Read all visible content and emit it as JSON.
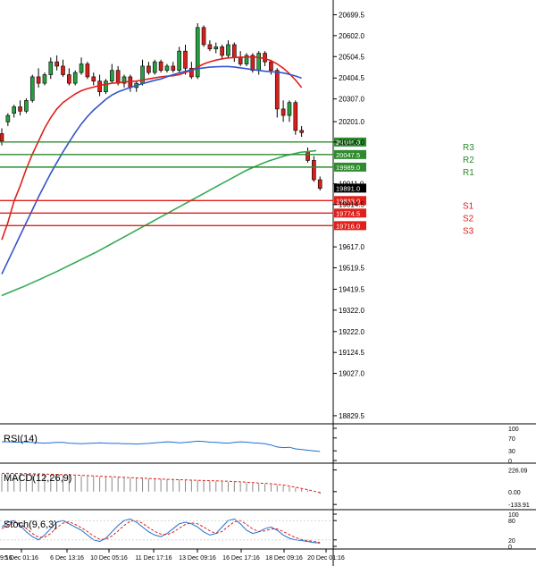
{
  "chart_data": [
    {
      "type": "candlestick",
      "title": "",
      "y_ticks": [
        "20699.5",
        "20602.0",
        "20504.5",
        "20404.5",
        "20307.0",
        "20201.0",
        "20106.0",
        "19911.0",
        "19814.5",
        "19617.0",
        "19519.5",
        "19419.5",
        "19322.0",
        "19222.0",
        "19124.5",
        "19027.0",
        "18829.5"
      ],
      "ylim": [
        18800,
        20760
      ],
      "x_ticks": [
        "5 Dec 01:16",
        "6 Dec 13:16",
        "10 Dec 05:16",
        "11 Dec 17:16",
        "13 Dec 09:16",
        "16 Dec 17:16",
        "18 Dec 09:16",
        "20 Dec 01:16"
      ],
      "x_tick_left_partial": "9:16",
      "current_price": "19891.0",
      "levels": [
        {
          "name": "R3",
          "value": 20106.0,
          "label": "20106.0",
          "color": "#2e8b2e"
        },
        {
          "name": "R2",
          "value": 20047.5,
          "label": "20047.5",
          "color": "#2e8b2e"
        },
        {
          "name": "R1",
          "value": 19989.0,
          "label": "19989.0",
          "color": "#2e8b2e"
        },
        {
          "name": "S1",
          "value": 19833.0,
          "label": "19833.0",
          "color": "#e0201a"
        },
        {
          "name": "S2",
          "value": 19774.5,
          "label": "19774.5",
          "color": "#e0201a"
        },
        {
          "name": "S3",
          "value": 19716.0,
          "label": "19716.0",
          "color": "#e0201a"
        }
      ],
      "hidden_label_fragments": [
        "20013.0",
        "19814.5"
      ],
      "candles": [
        {
          "o": 20145,
          "h": 20170,
          "c": 20110,
          "l": 20090
        },
        {
          "o": 20200,
          "h": 20240,
          "c": 20230,
          "l": 20180
        },
        {
          "o": 20240,
          "h": 20280,
          "c": 20270,
          "l": 20220
        },
        {
          "o": 20270,
          "h": 20300,
          "c": 20250,
          "l": 20230
        },
        {
          "o": 20250,
          "h": 20310,
          "c": 20300,
          "l": 20240
        },
        {
          "o": 20300,
          "h": 20420,
          "c": 20410,
          "l": 20290
        },
        {
          "o": 20410,
          "h": 20450,
          "c": 20380,
          "l": 20360
        },
        {
          "o": 20380,
          "h": 20430,
          "c": 20420,
          "l": 20370
        },
        {
          "o": 20420,
          "h": 20500,
          "c": 20480,
          "l": 20400
        },
        {
          "o": 20480,
          "h": 20510,
          "c": 20460,
          "l": 20440
        },
        {
          "o": 20460,
          "h": 20490,
          "c": 20420,
          "l": 20410
        },
        {
          "o": 20420,
          "h": 20450,
          "c": 20380,
          "l": 20370
        },
        {
          "o": 20380,
          "h": 20440,
          "c": 20430,
          "l": 20370
        },
        {
          "o": 20430,
          "h": 20500,
          "c": 20470,
          "l": 20420
        },
        {
          "o": 20470,
          "h": 20480,
          "c": 20410,
          "l": 20400
        },
        {
          "o": 20410,
          "h": 20430,
          "c": 20390,
          "l": 20370
        },
        {
          "o": 20390,
          "h": 20420,
          "c": 20340,
          "l": 20320
        },
        {
          "o": 20340,
          "h": 20400,
          "c": 20390,
          "l": 20330
        },
        {
          "o": 20390,
          "h": 20470,
          "c": 20440,
          "l": 20380
        },
        {
          "o": 20440,
          "h": 20460,
          "c": 20380,
          "l": 20370
        },
        {
          "o": 20380,
          "h": 20420,
          "c": 20410,
          "l": 20360
        },
        {
          "o": 20410,
          "h": 20420,
          "c": 20360,
          "l": 20340
        },
        {
          "o": 20360,
          "h": 20390,
          "c": 20380,
          "l": 20340
        },
        {
          "o": 20380,
          "h": 20490,
          "c": 20460,
          "l": 20370
        },
        {
          "o": 20460,
          "h": 20480,
          "c": 20430,
          "l": 20420
        },
        {
          "o": 20430,
          "h": 20490,
          "c": 20480,
          "l": 20420
        },
        {
          "o": 20480,
          "h": 20490,
          "c": 20440,
          "l": 20430
        },
        {
          "o": 20440,
          "h": 20470,
          "c": 20460,
          "l": 20430
        },
        {
          "o": 20460,
          "h": 20480,
          "c": 20440,
          "l": 20430
        },
        {
          "o": 20440,
          "h": 20550,
          "c": 20530,
          "l": 20430
        },
        {
          "o": 20530,
          "h": 20560,
          "c": 20450,
          "l": 20420
        },
        {
          "o": 20450,
          "h": 20480,
          "c": 20410,
          "l": 20400
        },
        {
          "o": 20410,
          "h": 20660,
          "c": 20640,
          "l": 20400
        },
        {
          "o": 20640,
          "h": 20650,
          "c": 20560,
          "l": 20550
        },
        {
          "o": 20560,
          "h": 20580,
          "c": 20540,
          "l": 20530
        },
        {
          "o": 20540,
          "h": 20570,
          "c": 20550,
          "l": 20520
        },
        {
          "o": 20550,
          "h": 20560,
          "c": 20510,
          "l": 20490
        },
        {
          "o": 20510,
          "h": 20580,
          "c": 20560,
          "l": 20500
        },
        {
          "o": 20560,
          "h": 20570,
          "c": 20500,
          "l": 20480
        },
        {
          "o": 20500,
          "h": 20530,
          "c": 20470,
          "l": 20460
        },
        {
          "o": 20470,
          "h": 20520,
          "c": 20510,
          "l": 20460
        },
        {
          "o": 20510,
          "h": 20520,
          "c": 20440,
          "l": 20430
        },
        {
          "o": 20440,
          "h": 20530,
          "c": 20520,
          "l": 20420
        },
        {
          "o": 20520,
          "h": 20530,
          "c": 20480,
          "l": 20460
        },
        {
          "o": 20480,
          "h": 20490,
          "c": 20440,
          "l": 20420
        },
        {
          "o": 20440,
          "h": 20450,
          "c": 20260,
          "l": 20220
        },
        {
          "o": 20260,
          "h": 20300,
          "c": 20230,
          "l": 20200
        },
        {
          "o": 20230,
          "h": 20300,
          "c": 20290,
          "l": 20200
        },
        {
          "o": 20290,
          "h": 20300,
          "c": 20160,
          "l": 20140
        },
        {
          "o": 20160,
          "h": 20180,
          "c": 20150,
          "l": 20130
        },
        {
          "o": 20060,
          "h": 20080,
          "c": 20020,
          "l": 20010
        },
        {
          "o": 20020,
          "h": 20040,
          "c": 19930,
          "l": 19920
        },
        {
          "o": 19930,
          "h": 19945,
          "c": 19890,
          "l": 19880
        }
      ],
      "ma_fast": {
        "color": "#e0201a",
        "values": [
          19650,
          19730,
          19830,
          19900,
          19980,
          20050,
          20110,
          20170,
          20220,
          20260,
          20290,
          20310,
          20330,
          20345,
          20355,
          20362,
          20370,
          20375,
          20380,
          20383,
          20386,
          20388,
          20390,
          20395,
          20400,
          20405,
          20410,
          20413,
          20415,
          20420,
          20430,
          20440,
          20455,
          20470,
          20480,
          20488,
          20494,
          20498,
          20500,
          20502,
          20502,
          20503,
          20500,
          20495,
          20485,
          20470,
          20450,
          20425,
          20395,
          20360
        ]
      },
      "ma_mid": {
        "color": "#3355cc",
        "values": [
          19490,
          19550,
          19610,
          19670,
          19730,
          19790,
          19850,
          19905,
          19960,
          20010,
          20060,
          20105,
          20150,
          20190,
          20225,
          20255,
          20280,
          20305,
          20325,
          20340,
          20350,
          20360,
          20370,
          20378,
          20386,
          20394,
          20400,
          20410,
          20420,
          20428,
          20436,
          20442,
          20448,
          20452,
          20455,
          20457,
          20458,
          20458,
          20456,
          20452,
          20448,
          20444,
          20440,
          20436,
          20434,
          20432,
          20428,
          20422,
          20414,
          20404
        ]
      },
      "ma_slow": {
        "color": "#33aa55",
        "values": [
          19390,
          19405,
          19420,
          19435,
          19452,
          19468,
          19485,
          19502,
          19520,
          19538,
          19556,
          19574,
          19592,
          19612,
          19632,
          19652,
          19672,
          19692,
          19712,
          19732,
          19752,
          19772,
          19792,
          19812,
          19832,
          19852,
          19872,
          19892,
          19912,
          19932,
          19952,
          19972,
          19988,
          20004,
          20018,
          20030,
          20042,
          20050,
          20058,
          20062,
          20066
        ]
      }
    },
    {
      "type": "line",
      "title": "RSI(14)",
      "y_ticks": [
        "100",
        "70",
        "30",
        "0"
      ],
      "ylim": [
        0,
        100
      ],
      "series": [
        {
          "color": "#1f6fd0",
          "values": [
            58,
            58,
            57,
            57,
            58,
            56,
            55,
            54,
            55,
            56,
            56,
            54,
            53,
            52,
            53,
            54,
            55,
            54,
            53,
            53,
            52,
            52,
            51,
            52,
            53,
            55,
            56,
            58,
            57,
            55,
            56,
            58,
            60,
            59,
            57,
            56,
            55,
            54,
            56,
            58,
            57,
            55,
            54,
            52,
            48,
            42,
            40,
            41,
            36,
            34,
            32,
            30,
            28
          ]
        }
      ]
    },
    {
      "type": "bar+line",
      "title": "MACD(12,26,9)",
      "y_ticks": [
        "226.09",
        "0.00",
        "-133.91"
      ],
      "ylim": [
        -160,
        250
      ],
      "histogram": [
        185,
        185,
        184,
        183,
        182,
        180,
        178,
        176,
        174,
        172,
        170,
        168,
        165,
        162,
        160,
        158,
        155,
        152,
        150,
        148,
        145,
        142,
        140,
        138,
        135,
        132,
        130,
        128,
        126,
        124,
        121,
        118,
        115,
        112,
        109,
        106,
        103,
        100,
        97,
        94,
        90,
        86,
        82,
        78,
        74,
        68,
        60,
        50,
        40,
        28,
        15,
        0,
        -25
      ],
      "signal": [
        190,
        190,
        189,
        188,
        187,
        186,
        185,
        183,
        181,
        179,
        177,
        175,
        173,
        170,
        167,
        164,
        161,
        158,
        155,
        152,
        149,
        146,
        143,
        140,
        137,
        134,
        131,
        128,
        126,
        124,
        122,
        120,
        118,
        116,
        114,
        112,
        110,
        108,
        105,
        102,
        98,
        94,
        90,
        86,
        82,
        76,
        68,
        58,
        46,
        34,
        20,
        5,
        -10
      ]
    },
    {
      "type": "line",
      "title": "Stoch(9,6,3)",
      "y_ticks": [
        "100",
        "80",
        "20",
        "0"
      ],
      "ylim": [
        0,
        100
      ],
      "series": [
        {
          "color": "#1f6fd0",
          "values": [
            60,
            75,
            80,
            65,
            45,
            30,
            20,
            35,
            55,
            75,
            80,
            70,
            60,
            50,
            35,
            20,
            15,
            25,
            45,
            65,
            80,
            85,
            75,
            60,
            45,
            35,
            30,
            40,
            55,
            70,
            75,
            70,
            60,
            45,
            35,
            40,
            60,
            80,
            85,
            70,
            50,
            40,
            45,
            55,
            60,
            50,
            35,
            25,
            20,
            18,
            15,
            12,
            10
          ]
        },
        {
          "color": "#e0201a",
          "dash": "3,2",
          "values": [
            55,
            65,
            75,
            72,
            55,
            40,
            28,
            28,
            40,
            58,
            72,
            76,
            68,
            58,
            46,
            32,
            22,
            22,
            32,
            48,
            65,
            78,
            80,
            72,
            58,
            46,
            38,
            36,
            44,
            56,
            68,
            73,
            70,
            60,
            48,
            40,
            46,
            62,
            76,
            80,
            68,
            54,
            46,
            48,
            54,
            54,
            46,
            36,
            27,
            21,
            18,
            15,
            12
          ]
        }
      ]
    }
  ]
}
